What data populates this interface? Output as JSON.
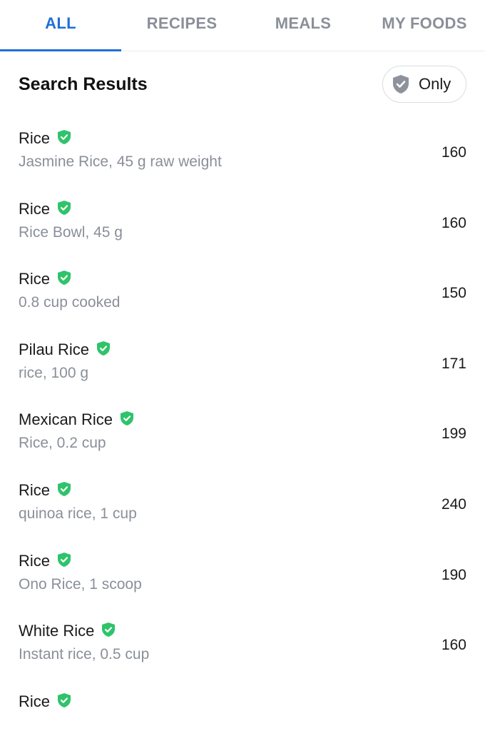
{
  "tabs": [
    {
      "label": "ALL",
      "active": true
    },
    {
      "label": "RECIPES",
      "active": false
    },
    {
      "label": "MEALS",
      "active": false
    },
    {
      "label": "MY FOODS",
      "active": false
    }
  ],
  "header": {
    "title": "Search Results",
    "filter_label": "Only"
  },
  "colors": {
    "accent": "#1f6fd6",
    "verified": "#2fc36b",
    "muted": "#8a8f98",
    "filter_shield": "#8e939b"
  },
  "icons": {
    "verified": "verified-shield-icon",
    "filter": "shield-check-icon"
  },
  "results": [
    {
      "name": "Rice",
      "desc": "Jasmine  Rice, 45 g raw weight",
      "calories": "160"
    },
    {
      "name": "Rice",
      "desc": "Rice Bowl, 45 g",
      "calories": "160"
    },
    {
      "name": "Rice",
      "desc": "0.8 cup cooked",
      "calories": "150"
    },
    {
      "name": "Pilau Rice",
      "desc": "rice, 100 g",
      "calories": "171"
    },
    {
      "name": "Mexican Rice",
      "desc": "Rice, 0.2 cup",
      "calories": "199"
    },
    {
      "name": "Rice",
      "desc": "quinoa rice, 1 cup",
      "calories": "240"
    },
    {
      "name": "Rice",
      "desc": "Ono Rice, 1 scoop",
      "calories": "190"
    },
    {
      "name": "White Rice",
      "desc": "Instant rice, 0.5 cup",
      "calories": "160"
    },
    {
      "name": "Rice",
      "desc": "",
      "calories": ""
    }
  ]
}
